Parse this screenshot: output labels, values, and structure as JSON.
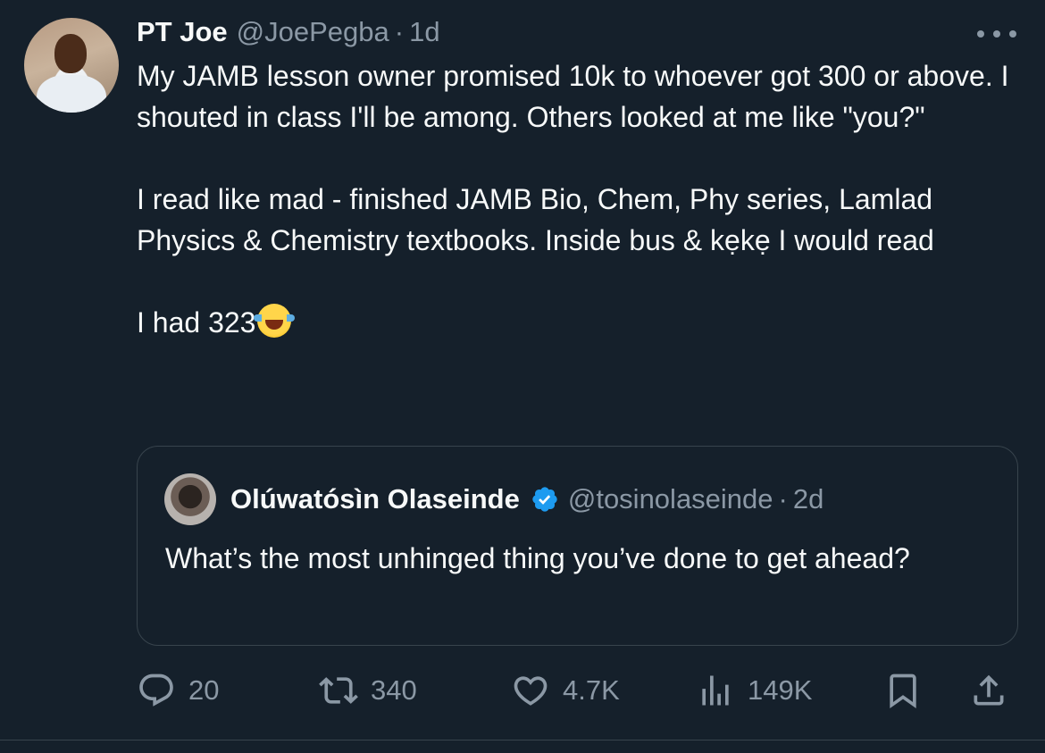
{
  "tweet": {
    "author_name": "PT Joe",
    "author_handle": "@JoePegba",
    "separator": "·",
    "time": "1d",
    "paragraphs": [
      "My JAMB lesson owner promised 10k to whoever got 300 or above. I shouted in class I'll be among. Others looked at me like \"you?\"",
      "I read like mad - finished JAMB Bio, Chem, Phy series, Lamlad Physics & Chemistry textbooks. Inside bus & kẹkẹ I would read",
      "I had 323"
    ],
    "emoji": "face-with-tears-of-joy"
  },
  "quote": {
    "author_name": "Olúwatósìn Olaseinde",
    "author_handle": "@tosinolaseinde",
    "separator": "·",
    "time": "2d",
    "verified": true,
    "text": "What’s the most unhinged thing you’ve done to get ahead?"
  },
  "actions": {
    "replies": "20",
    "reposts": "340",
    "likes": "4.7K",
    "views": "149K"
  },
  "colors": {
    "background": "#15202b",
    "text": "#f7f9f9",
    "secondary": "#8b98a5",
    "border": "#38444d",
    "verified": "#1d9bf0"
  },
  "icons": [
    "reply-icon",
    "repost-icon",
    "like-icon",
    "views-icon",
    "bookmark-icon",
    "share-icon",
    "more-icon",
    "verified-badge-icon"
  ]
}
